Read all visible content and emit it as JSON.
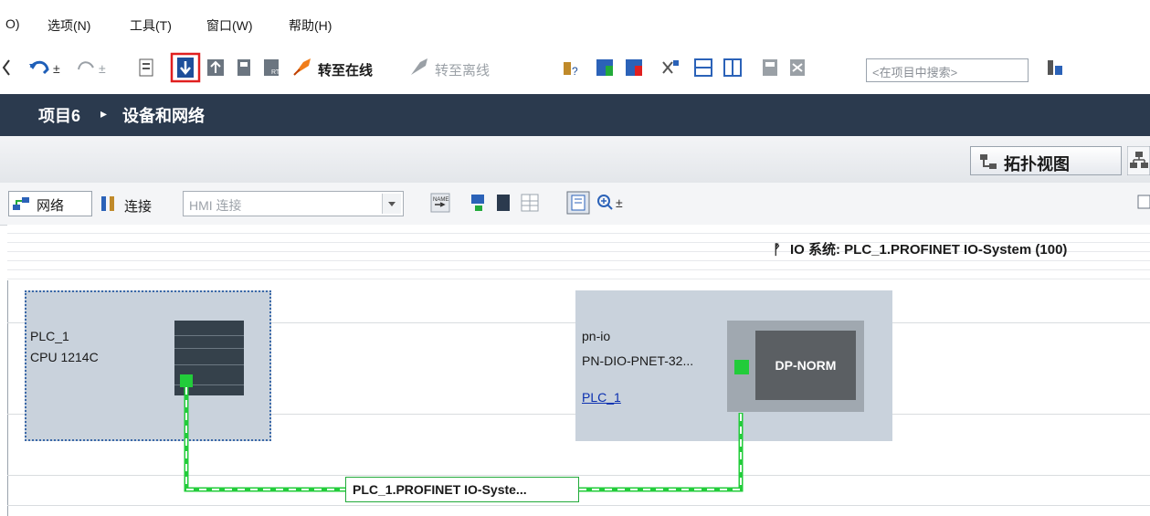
{
  "menubar": {
    "items": [
      "O)",
      "选项(N)",
      "工具(T)",
      "窗口(W)",
      "帮助(H)"
    ]
  },
  "toolbar": {
    "go_online": "转至在线",
    "go_offline": "转至离线",
    "search_placeholder": "<在项目中搜索>"
  },
  "breadcrumb": {
    "project": "项目6",
    "separator": "▸",
    "page": "设备和网络"
  },
  "views": {
    "topology": "拓扑视图"
  },
  "network_toolbar": {
    "network": "网络",
    "connections": "连接",
    "connection_type": "HMI 连接"
  },
  "io_system": {
    "pin": "ᚡ",
    "label": "IO 系统: PLC_1.PROFINET IO-System (100)"
  },
  "devices": {
    "plc": {
      "name": "PLC_1",
      "type": "CPU 1214C"
    },
    "pnio": {
      "name": "pn-io",
      "type": "PN-DIO-PNET-32...",
      "io_controller": "PLC_1",
      "module": "DP-NORM"
    }
  },
  "network": {
    "subnet_label": "PLC_1.PROFINET IO-Syste..."
  },
  "colors": {
    "title_bg": "#2b3a4e",
    "device_bg": "#c9d2dc",
    "profinet_green": "#22cc3a",
    "highlight_red": "#e02020"
  }
}
